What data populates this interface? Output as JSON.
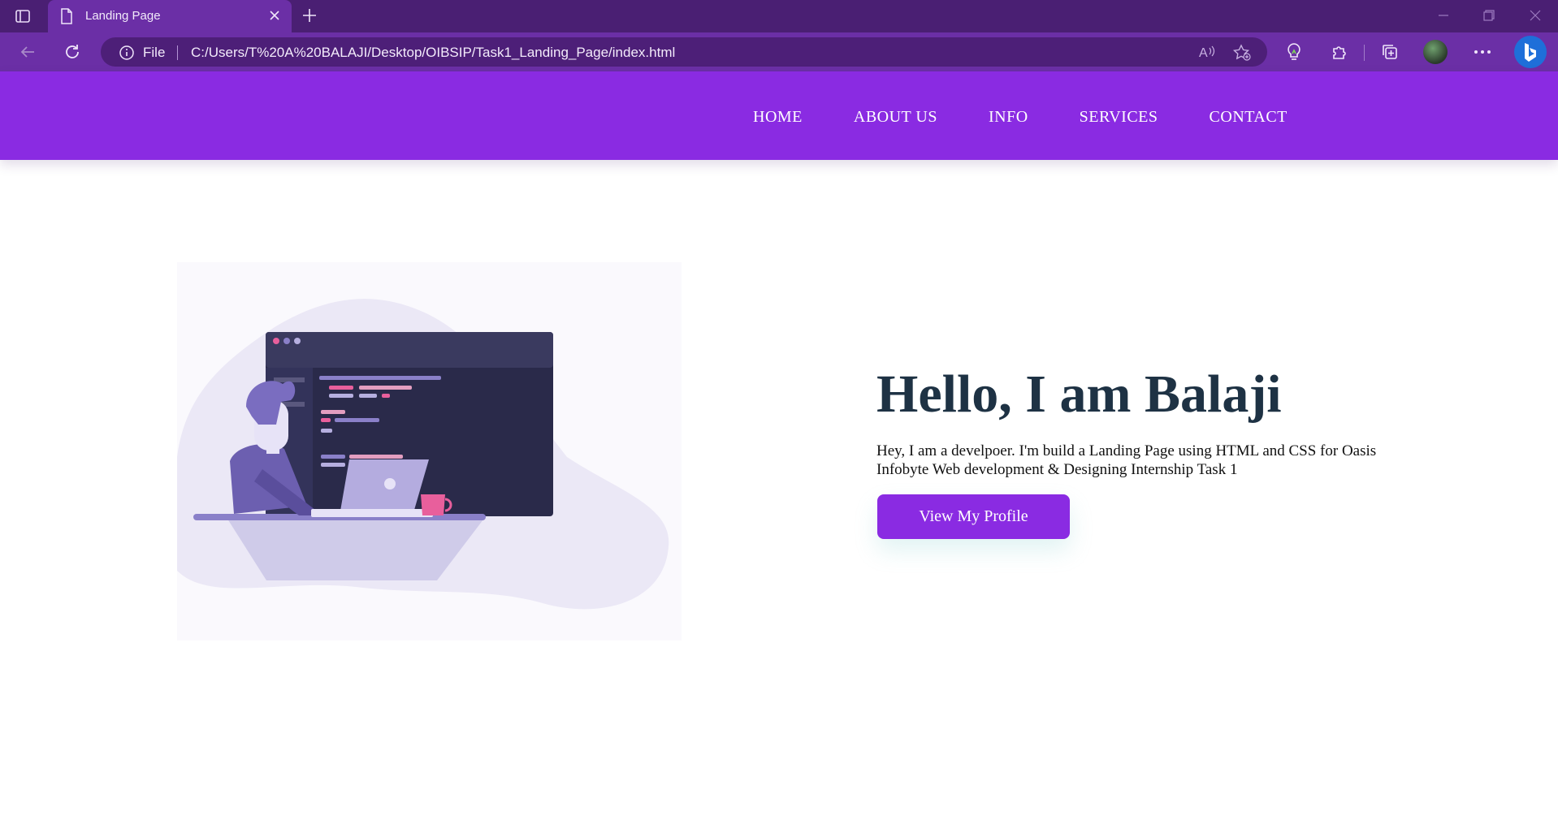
{
  "browser": {
    "tab_title": "Landing Page",
    "file_label": "File",
    "url": "C:/Users/T%20A%20BALAJI/Desktop/OIBSIP/Task1_Landing_Page/index.html"
  },
  "site": {
    "accent": "#8a2be2",
    "title_color": "#1e3244",
    "nav": [
      {
        "label": "HOME"
      },
      {
        "label": "ABOUT US"
      },
      {
        "label": "INFO"
      },
      {
        "label": "SERVICES"
      },
      {
        "label": "CONTACT"
      }
    ],
    "hero": {
      "title": "Hello, I am Balaji",
      "description": "Hey, I am a develpoer. I'm build a Landing Page using HTML and CSS for Oasis Infobyte Web development & Designing Internship Task 1",
      "button": "View My Profile",
      "image_icon": "developer-illustration-icon"
    }
  }
}
